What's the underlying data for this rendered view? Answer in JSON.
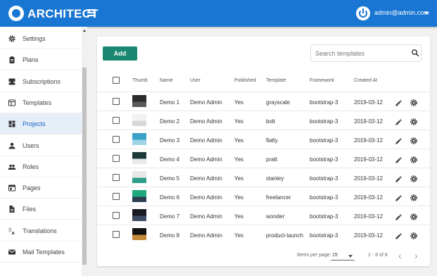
{
  "app": {
    "brand": "ARCHITECT",
    "user_email": "admin@admin.com"
  },
  "sidebar": {
    "active": "Projects",
    "items": [
      {
        "label": "Settings",
        "icon": "gear-icon"
      },
      {
        "label": "Plans",
        "icon": "clipboard-icon"
      },
      {
        "label": "Subscriptions",
        "icon": "inbox-icon"
      },
      {
        "label": "Templates",
        "icon": "template-icon"
      },
      {
        "label": "Projects",
        "icon": "dashboard-icon"
      },
      {
        "label": "Users",
        "icon": "person-icon"
      },
      {
        "label": "Roles",
        "icon": "people-icon"
      },
      {
        "label": "Pages",
        "icon": "page-icon"
      },
      {
        "label": "Files",
        "icon": "file-icon"
      },
      {
        "label": "Translations",
        "icon": "translate-icon"
      },
      {
        "label": "Mail Templates",
        "icon": "mail-icon"
      }
    ]
  },
  "toolbar": {
    "add_label": "Add",
    "search_placeholder": "Search templates"
  },
  "table": {
    "headers": [
      "Thumb",
      "Name",
      "User",
      "Published",
      "Template",
      "Framework",
      "Created At"
    ],
    "rows": [
      {
        "name": "Demo 1",
        "user": "Demo Admin",
        "published": "Yes",
        "template": "grayscale",
        "framework": "bootstrap-3",
        "created": "2019-03-12",
        "thumb": [
          "#2b2b2b",
          "#5a5a5a"
        ]
      },
      {
        "name": "Demo 2",
        "user": "Demo Admin",
        "published": "Yes",
        "template": "bolt",
        "framework": "bootstrap-3",
        "created": "2019-03-12",
        "thumb": [
          "#f2f2f2",
          "#d8d8d8"
        ]
      },
      {
        "name": "Demo 3",
        "user": "Demo Admin",
        "published": "Yes",
        "template": "flatty",
        "framework": "bootstrap-3",
        "created": "2019-03-12",
        "thumb": [
          "#3aa0c8",
          "#9fd3e6"
        ]
      },
      {
        "name": "Demo 4",
        "user": "Demo Admin",
        "published": "Yes",
        "template": "pratt",
        "framework": "bootstrap-3",
        "created": "2019-03-12",
        "thumb": [
          "#1d3a3a",
          "#e9e9e9"
        ]
      },
      {
        "name": "Demo 5",
        "user": "Demo Admin",
        "published": "Yes",
        "template": "stanley",
        "framework": "bootstrap-3",
        "created": "2019-03-12",
        "thumb": [
          "#e8e8e8",
          "#2e9e8a"
        ]
      },
      {
        "name": "Demo 6",
        "user": "Demo Admin",
        "published": "Yes",
        "template": "freelancer",
        "framework": "bootstrap-3",
        "created": "2019-03-12",
        "thumb": [
          "#1fa87f",
          "#2c3e50"
        ]
      },
      {
        "name": "Demo 7",
        "user": "Demo Admin",
        "published": "Yes",
        "template": "wonder",
        "framework": "bootstrap-3",
        "created": "2019-03-12",
        "thumb": [
          "#1a1a24",
          "#3d4a66"
        ]
      },
      {
        "name": "Demo 8",
        "user": "Demo Admin",
        "published": "Yes",
        "template": "product-launch",
        "framework": "bootstrap-3",
        "created": "2019-03-12",
        "thumb": [
          "#111111",
          "#c48a3a"
        ]
      }
    ]
  },
  "pagination": {
    "items_per_page_label": "Items per page:",
    "per_page": "15",
    "range": "1 - 8 of 8"
  },
  "colors": {
    "primary": "#1976d2",
    "accent": "#1a8870",
    "active_bg": "#e6eef8"
  }
}
